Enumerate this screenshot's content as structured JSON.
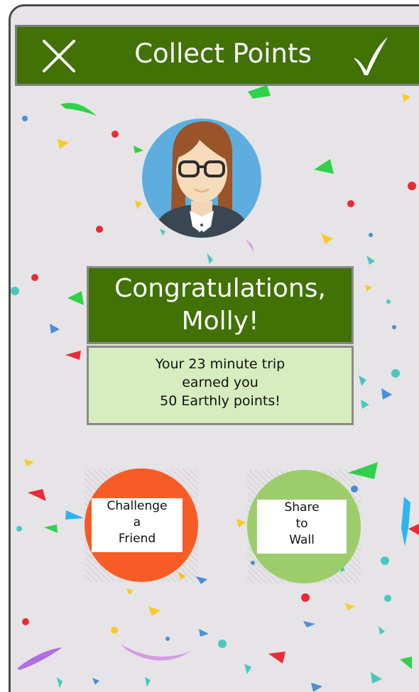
{
  "header": {
    "title": "Collect Points",
    "close_icon": "close-x-icon",
    "confirm_icon": "checkmark-icon",
    "background_color": "#427106"
  },
  "profile": {
    "avatar_icon": "woman-avatar-icon",
    "congrats_line1": "Congratulations,",
    "congrats_line2": "Molly!"
  },
  "message": {
    "line1": "Your 23 minute trip",
    "line2": "earned you",
    "line3": "50 Earthly points!"
  },
  "actions": {
    "challenge": {
      "line1": "Challenge",
      "line2": "a",
      "line3": "Friend",
      "color": "#f75c27"
    },
    "share": {
      "line1": "Share",
      "line2": "to",
      "line3": "Wall",
      "color": "#9ccd6a"
    }
  }
}
